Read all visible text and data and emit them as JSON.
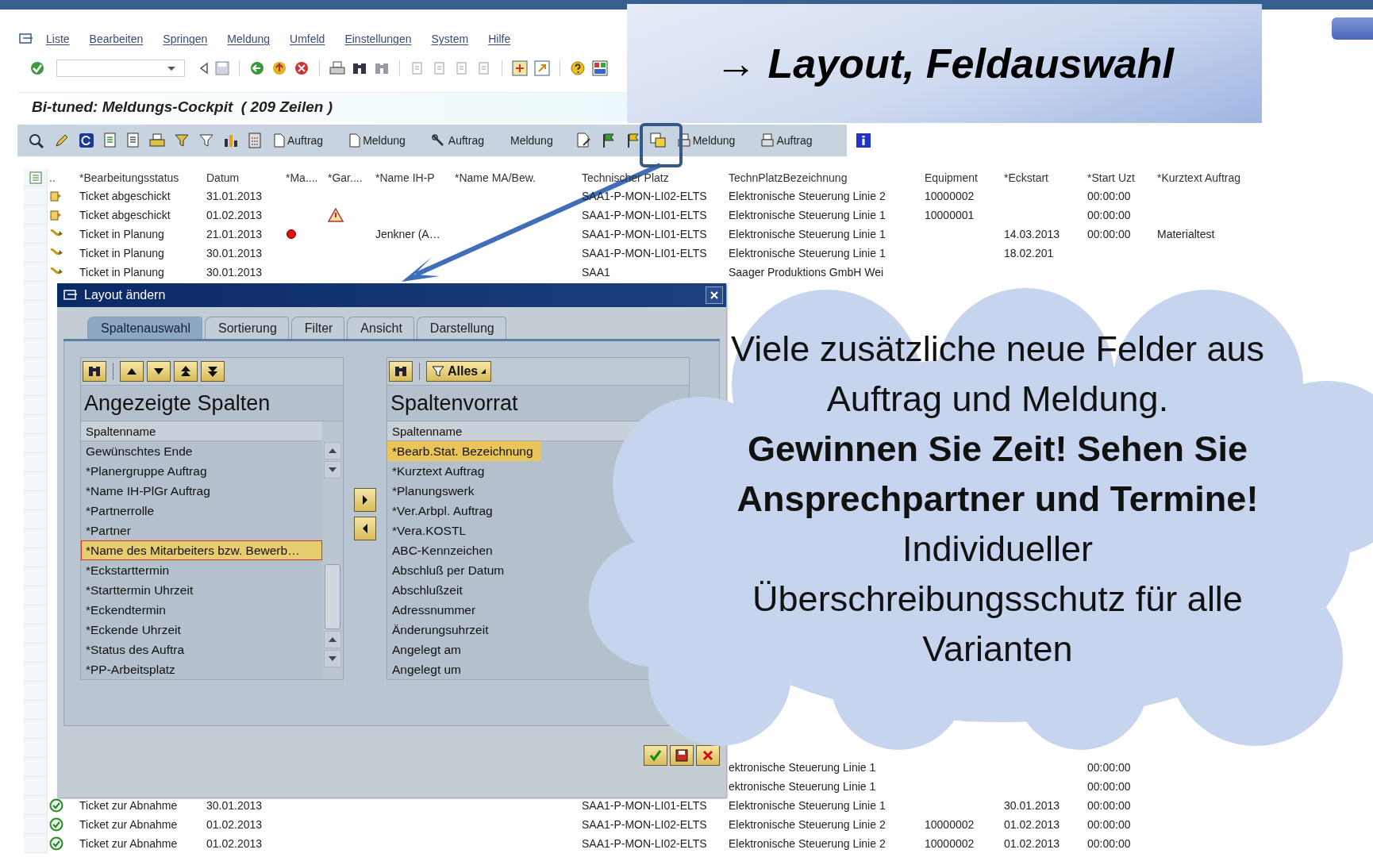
{
  "menu": [
    "Liste",
    "Bearbeiten",
    "Springen",
    "Meldung",
    "Umfeld",
    "Einstellungen",
    "System",
    "Hilfe"
  ],
  "title": "Bi-tuned: Meldungs-Cockpit  ( 209 Zeilen )",
  "app_toolbar": {
    "buttons": [
      "Auftrag",
      "Meldung",
      "Auftrag",
      "Meldung",
      "Meldung",
      "Auftrag"
    ]
  },
  "callout": {
    "text": "→ Layout, Feldauswahl"
  },
  "table": {
    "columns": [
      "..",
      "*Bearbeitungsstatus",
      "Datum",
      "*Ma....",
      "*Gar....",
      "*Name IH-P",
      "*Name MA/Bew.",
      "Technischer Platz",
      "TechnPlatzBezeichnung",
      "Equipment",
      "*Eckstart",
      "*Start Uzt",
      "*Kurztext Auftrag"
    ],
    "rows": [
      {
        "kind": "sent",
        "status": "Ticket abgeschickt",
        "datum": "31.01.2013",
        "ma_flag": false,
        "gar_flag": false,
        "platz": "SAA1-P-MON-LI02-ELTS",
        "bezeichnung": "Elektronische Steuerung Linie 2",
        "equipment": "10000002",
        "start": "00:00:00"
      },
      {
        "kind": "sent",
        "status": "Ticket abgeschickt",
        "datum": "01.02.2013",
        "ma_flag": false,
        "gar_flag": true,
        "platz": "SAA1-P-MON-LI01-ELTS",
        "bezeichnung": "Elektronische Steuerung Linie 1",
        "equipment": "10000001",
        "start": "00:00:00"
      },
      {
        "kind": "planning",
        "status": "Ticket in Planung",
        "datum": "21.01.2013",
        "ma_flag": true,
        "gar_flag": false,
        "name_ih": "Jenkner (A…",
        "platz": "SAA1-P-MON-LI01-ELTS",
        "bezeichnung": "Elektronische Steuerung Linie 1",
        "eckstart": "14.03.2013",
        "start": "00:00:00",
        "kurztext": "Materialtest"
      },
      {
        "kind": "planning",
        "status": "Ticket in Planung",
        "datum": "30.01.2013",
        "ma_flag": false,
        "gar_flag": false,
        "platz": "SAA1-P-MON-LI01-ELTS",
        "bezeichnung": "Elektronische Steuerung Linie 1",
        "eckstart": "18.02.201"
      },
      {
        "kind": "planning",
        "status": "Ticket in Planung",
        "datum": "30.01.2013",
        "ma_flag": false,
        "gar_flag": false,
        "platz": "SAA1",
        "bezeichnung": "Saager Produktions GmbH Wei"
      }
    ],
    "partial_rows": [
      {
        "bezeichnung": "ektronische Steuerung Linie 1",
        "start": "00:00:00"
      },
      {
        "bezeichnung": "ektronische Steuerung Linie 1",
        "start": "00:00:00"
      }
    ],
    "bottom_rows": [
      {
        "kind": "acceptance",
        "status": "Ticket zur Abnahme",
        "datum": "30.01.2013",
        "platz": "SAA1-P-MON-LI01-ELTS",
        "bezeichnung": "Elektronische Steuerung Linie 1",
        "eckstart": "30.01.2013",
        "start": "00:00:00"
      },
      {
        "kind": "acceptance",
        "status": "Ticket zur Abnahme",
        "datum": "01.02.2013",
        "platz": "SAA1-P-MON-LI02-ELTS",
        "bezeichnung": "Elektronische Steuerung Linie 2",
        "equipment": "10000002",
        "eckstart": "01.02.2013",
        "start": "00:00:00"
      },
      {
        "kind": "acceptance",
        "status": "Ticket zur Abnahme",
        "datum": "01.02.2013",
        "platz": "SAA1-P-MON-LI02-ELTS",
        "bezeichnung": "Elektronische Steuerung Linie 2",
        "equipment": "10000002",
        "eckstart": "01.02.2013",
        "start": "00:00:00"
      }
    ]
  },
  "dialog": {
    "title": "Layout ändern",
    "tabs": [
      {
        "label": "Spaltenauswahl",
        "selected": true
      },
      {
        "label": "Sortierung",
        "selected": false
      },
      {
        "label": "Filter",
        "selected": false
      },
      {
        "label": "Ansicht",
        "selected": false
      },
      {
        "label": "Darstellung",
        "selected": false
      }
    ],
    "displayed": {
      "heading": "Angezeigte Spalten",
      "column_header": "Spaltenname",
      "items": [
        {
          "label": "Gewünschtes Ende",
          "selected": false
        },
        {
          "label": "*Planergruppe Auftrag",
          "selected": false
        },
        {
          "label": "*Name IH-PlGr Auftrag",
          "selected": false
        },
        {
          "label": "*Partnerrolle",
          "selected": false
        },
        {
          "label": "*Partner",
          "selected": false
        },
        {
          "label": "*Name des Mitarbeiters bzw. Bewerb…",
          "selected": true
        },
        {
          "label": "*Eckstarttermin",
          "selected": false
        },
        {
          "label": "*Starttermin Uhrzeit",
          "selected": false
        },
        {
          "label": "*Eckendtermin",
          "selected": false
        },
        {
          "label": "*Eckende Uhrzeit",
          "selected": false
        },
        {
          "label": "*Status des Auftra",
          "selected": false
        },
        {
          "label": "*PP-Arbeitsplatz",
          "selected": false
        }
      ]
    },
    "available": {
      "heading": "Spaltenvorrat",
      "column_header": "Spaltenname",
      "filter_button": "Alles",
      "items": [
        {
          "label": "*Bearb.Stat. Bezeichnung",
          "selected": true
        },
        {
          "label": "*Kurztext Auftrag",
          "selected": false
        },
        {
          "label": "*Planungswerk",
          "selected": false
        },
        {
          "label": "*Ver.Arbpl. Auftrag",
          "selected": false
        },
        {
          "label": "*Vera.KOSTL",
          "selected": false
        },
        {
          "label": "ABC-Kennzeichen",
          "selected": false
        },
        {
          "label": "Abschluß per Datum",
          "selected": false
        },
        {
          "label": "Abschlußzeit",
          "selected": false
        },
        {
          "label": "Adressnummer",
          "selected": false
        },
        {
          "label": "Änderungsuhrzeit",
          "selected": false
        },
        {
          "label": "Angelegt am",
          "selected": false
        },
        {
          "label": "Angelegt um",
          "selected": false
        }
      ]
    }
  },
  "cloud": {
    "paragraphs": [
      {
        "text": "Viele zusätzliche neue Felder aus Auftrag und Meldung.",
        "bold": false
      },
      {
        "text": "Gewinnen Sie Zeit! Sehen Sie Ansprechpartner und Termine!",
        "bold": true
      },
      {
        "text": "Individueller Überschreibungsschutz für alle Varianten",
        "bold": false
      }
    ]
  }
}
